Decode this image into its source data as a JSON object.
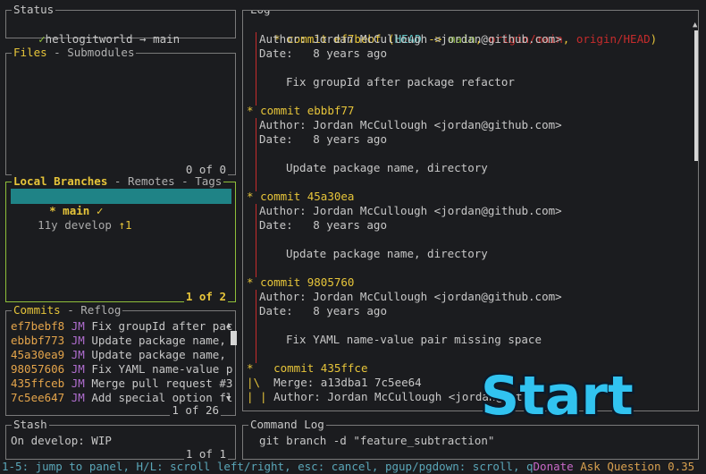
{
  "status": {
    "title": "Status",
    "check": "✓",
    "repo": "hellogitworld",
    "arrow": "→",
    "branch": "main"
  },
  "files": {
    "title": "Files",
    "sep": " - ",
    "tab2": "Submodules",
    "count": "0 of 0"
  },
  "branches": {
    "title": "Local Branches",
    "sep1": " - ",
    "tab2": "Remotes",
    "sep2": " - ",
    "tab3": "Tags",
    "rows": [
      {
        "age": "",
        "marker": "*",
        "name": "main",
        "status": "✓"
      },
      {
        "age": "11y",
        "name": "develop",
        "status": "↑1"
      }
    ],
    "count": "1 of 2"
  },
  "commits": {
    "title": "Commits",
    "sep": " - ",
    "tab2": "Reflog",
    "rows": [
      {
        "sha": "ef7bebf8",
        "author": "JM",
        "msg": "Fix groupId after pac"
      },
      {
        "sha": "ebbbf773",
        "author": "JM",
        "msg": "Update package name,"
      },
      {
        "sha": "45a30ea9",
        "author": "JM",
        "msg": "Update package name,"
      },
      {
        "sha": "98057606",
        "author": "JM",
        "msg": "Fix YAML name-value p"
      },
      {
        "sha": "435ffceb",
        "author": "JM",
        "msg": "Merge pull request #3"
      },
      {
        "sha": "7c5ee647",
        "author": "JM",
        "msg": "Add special option fl"
      }
    ],
    "count": "1 of 26"
  },
  "stash": {
    "title": "Stash",
    "entry": "On develop: WIP",
    "count": "1 of 1"
  },
  "log": {
    "title": "Log",
    "head_commit": {
      "prefix": "* commit ",
      "sha": "ef7bebf",
      "open": " (",
      "head": "HEAD",
      "arrow": " -> ",
      "branch": "main",
      "comma1": ", ",
      "ref1": "origin/main",
      "comma2": ", ",
      "ref2": "origin/HEAD",
      "close": ")"
    },
    "author_line": "Author: Jordan McCullough <jordan@github.com>",
    "date_line": "Date:   8 years ago",
    "commits": [
      {
        "sha": "ebbbf77",
        "msg": "Update package name, directory"
      },
      {
        "sha": "45a30ea",
        "msg": "Update package name, directory"
      },
      {
        "sha": "9805760",
        "msg": "Fix YAML name-value pair missing space"
      }
    ],
    "first_msg": "Fix groupId after package refactor",
    "merge_commit": {
      "prefix": "*   commit ",
      "sha": "435ffce",
      "merge": "Merge: a13dba1 7c5ee64",
      "author": "Author: Jordan McCullough <jordan@gith"
    },
    "commit_word": "commit "
  },
  "cmdlog": {
    "title": "Command Log",
    "cmd": "git branch -d \"feature_subtraction\""
  },
  "help": {
    "keys": "1-5: jump to panel, H/L: scroll left/right, esc: cancel, pgup/pgdown: scroll, q",
    "donate": "Donate",
    "ask": "Ask Question",
    "version": "0.35"
  },
  "overlay": {
    "text": "Start"
  },
  "colors": {
    "active_border": "#8fbf3a",
    "selection": "#1f8386",
    "sha": "#e5a54b",
    "branch_ref": "#c62c2c"
  }
}
